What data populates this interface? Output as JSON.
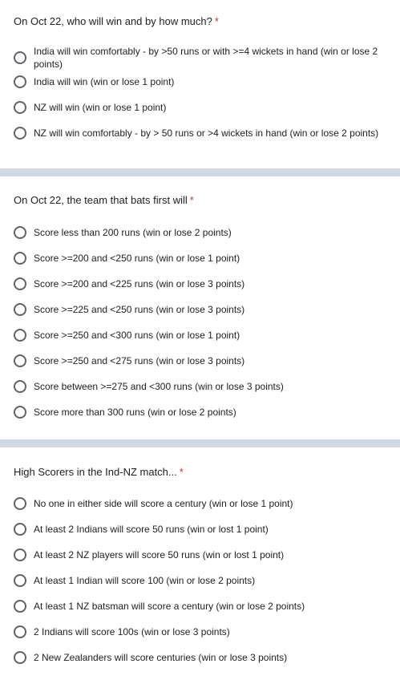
{
  "required_marker": "*",
  "questions": [
    {
      "title": "On Oct 22, who will win and by how much?",
      "options": [
        "India will win comfortably - by >50 runs or with >=4 wickets in hand  (win or lose 2 points)",
        "India will win (win or lose 1 point)",
        "NZ will win (win or lose 1 point)",
        "NZ will win comfortably - by > 50 runs or >4 wickets in hand  (win or lose 2 points)"
      ]
    },
    {
      "title": "On Oct 22, the team that bats first will",
      "options": [
        "Score less than 200 runs (win or lose 2 points)",
        "Score >=200 and <250 runs (win or lose 1 point)",
        "Score >=200 and <225 runs (win or lose 3 points)",
        "Score >=225 and <250 runs (win or lose 3 points)",
        "Score >=250  and <300 runs (win or lose 1 point)",
        "Score >=250 and <275 runs (win or lose 3 points)",
        "Score between >=275 and <300 runs (win or lose 3 points)",
        "Score more than 300 runs (win or lose 2 points)"
      ]
    },
    {
      "title": "High Scorers in the Ind-NZ match...",
      "options": [
        "No one in either side will score a century (win or lose 1 point)",
        "At least 2 Indians will score 50 runs (win or lost 1 point)",
        "At least 2 NZ players will score 50 runs (win or lost 1 point)",
        "At least 1 Indian will score 100 (win or lose 2 points)",
        "At least 1 NZ batsman will score a century (win or lose 2 points)",
        "2 Indians will score 100s (win or lose 3 points)",
        "2 New Zealanders will score centuries (win or lose 3 points)"
      ]
    }
  ]
}
